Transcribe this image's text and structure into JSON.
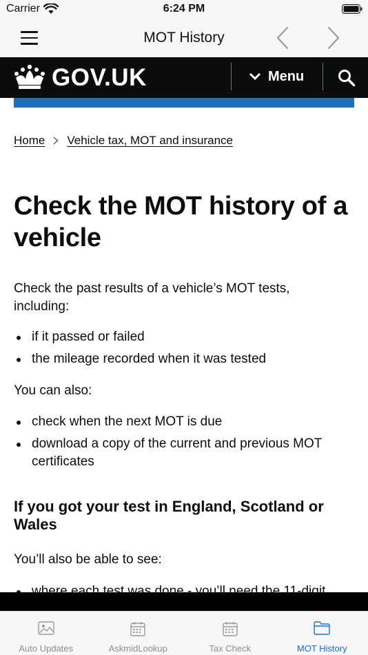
{
  "status_bar": {
    "carrier": "Carrier",
    "time": "6:24 PM"
  },
  "nav_bar": {
    "title": "MOT History"
  },
  "govuk_header": {
    "logotype": "GOV.UK",
    "menu_label": "Menu"
  },
  "breadcrumb": {
    "home": "Home",
    "section": "Vehicle tax, MOT and insurance"
  },
  "page": {
    "title": "Check the MOT history of a vehicle",
    "intro": "Check the past results of a vehicle’s MOT tests, including:",
    "list_1": [
      "if it passed or failed",
      "the mileage recorded when it was tested"
    ],
    "also_text": "You can also:",
    "list_2": [
      "check when the next MOT is due",
      "download a copy of the current and previous MOT certificates"
    ],
    "section_heading": "If you got your test in England, Scotland or Wales",
    "see_text": "You’ll also be able to see:",
    "list_3": [
      "where each test was done - you’ll need the 11-digit"
    ]
  },
  "tab_bar": {
    "tabs": [
      {
        "label": "Auto Updates",
        "icon": "image-icon"
      },
      {
        "label": "AskmidLookup",
        "icon": "calendar-icon"
      },
      {
        "label": "Tax Check",
        "icon": "calendar-icon"
      },
      {
        "label": "MOT History",
        "icon": "folder-icon"
      }
    ],
    "active_color": "#1a6fe0",
    "inactive_color": "#8e8e93"
  },
  "colors": {
    "govuk_black": "#0b0c0c",
    "govuk_blue": "#1d70b8"
  }
}
